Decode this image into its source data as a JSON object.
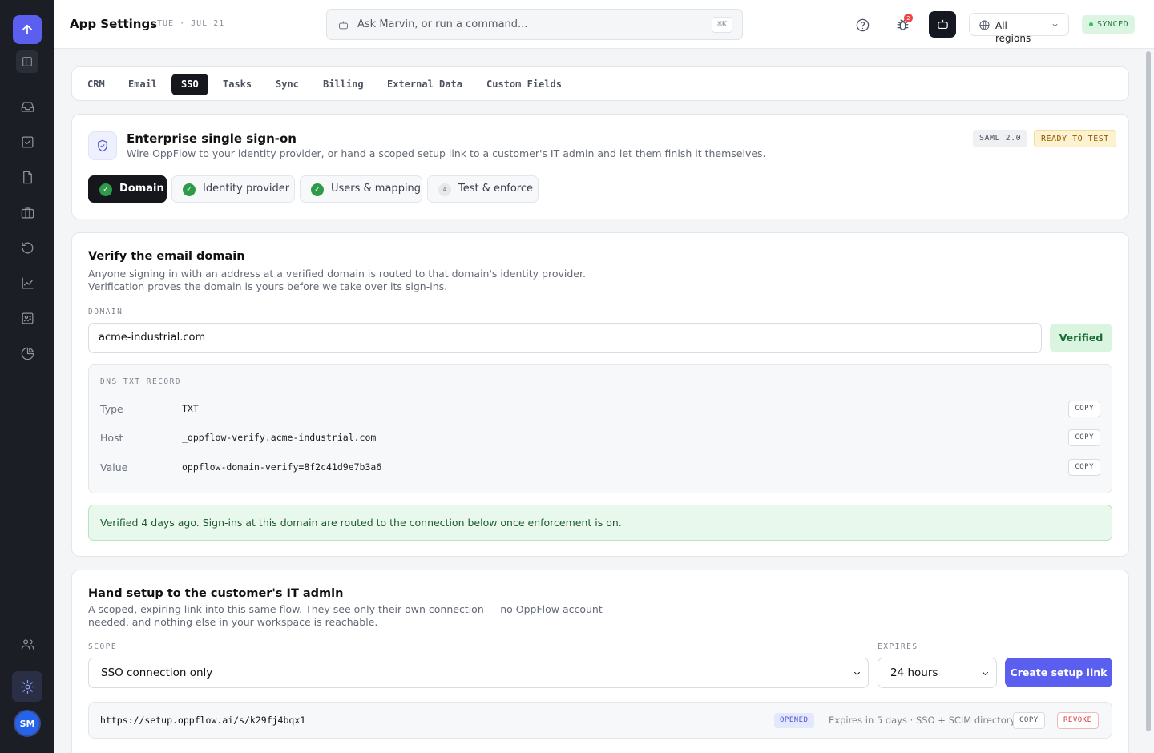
{
  "header": {
    "title": "App Settings",
    "date": "TUE · JUL 21",
    "search_placeholder": "Ask Marvin, or run a command...",
    "search_shortcut": "⌘K",
    "bug_count": "2",
    "region_label": "All regions",
    "sync_status": "SYNCED"
  },
  "sidebar": {
    "user_initials": "SM"
  },
  "tabs": [
    "CRM",
    "Email",
    "SSO",
    "Tasks",
    "Sync",
    "Billing",
    "External Data",
    "Custom Fields"
  ],
  "sso": {
    "title": "Enterprise single sign-on",
    "subtitle": "Wire OppFlow to your identity provider, or hand a scoped setup link to a customer's IT admin and let them finish it themselves.",
    "protocol_badge": "SAML 2.0",
    "status_badge": "READY TO TEST",
    "steps": [
      {
        "label": "Domain",
        "mark": "✓"
      },
      {
        "label": "Identity provider",
        "mark": "✓"
      },
      {
        "label": "Users & mapping",
        "mark": "✓"
      },
      {
        "label": "Test & enforce",
        "mark": "4"
      }
    ]
  },
  "domain": {
    "title": "Verify the email domain",
    "description_1": "Anyone signing in with an address at a verified domain is routed to that domain's identity provider.",
    "description_2": "Verification proves the domain is yours before we take over its sign-ins.",
    "field_label": "DOMAIN",
    "value": "acme-industrial.com",
    "verified_label": "Verified",
    "dns_title": "DNS TXT RECORD",
    "dns_rows": [
      {
        "key": "Type",
        "value": "TXT",
        "action": "COPY"
      },
      {
        "key": "Host",
        "value": "_oppflow-verify.acme-industrial.com",
        "action": "COPY"
      },
      {
        "key": "Value",
        "value": "oppflow-domain-verify=8f2c41d9e7b3a6",
        "action": "COPY"
      }
    ],
    "success_message": "Verified 4 days ago. Sign-ins at this domain are routed to the connection below once enforcement is on."
  },
  "handoff": {
    "title": "Hand setup to the customer's IT admin",
    "description_1": "A scoped, expiring link into this same flow. They see only their own connection — no OppFlow account",
    "description_2": "needed, and nothing else in your workspace is reachable.",
    "scope_label": "SCOPE",
    "scope_value": "SSO connection only",
    "expires_label": "EXPIRES",
    "expires_value": "24 hours",
    "create_button": "Create setup link",
    "link": {
      "url": "https://setup.oppflow.ai/s/k29fj4bqx1",
      "status": "OPENED",
      "details": "Expires in 5 days · SSO + SCIM directory",
      "copy": "COPY",
      "revoke": "REVOKE"
    }
  },
  "colors": {
    "accent": "#5b5ff0",
    "sidebar_bg": "#1b1e25",
    "success": "#2e9a4a",
    "warning_badge": "#fdf2cf"
  }
}
